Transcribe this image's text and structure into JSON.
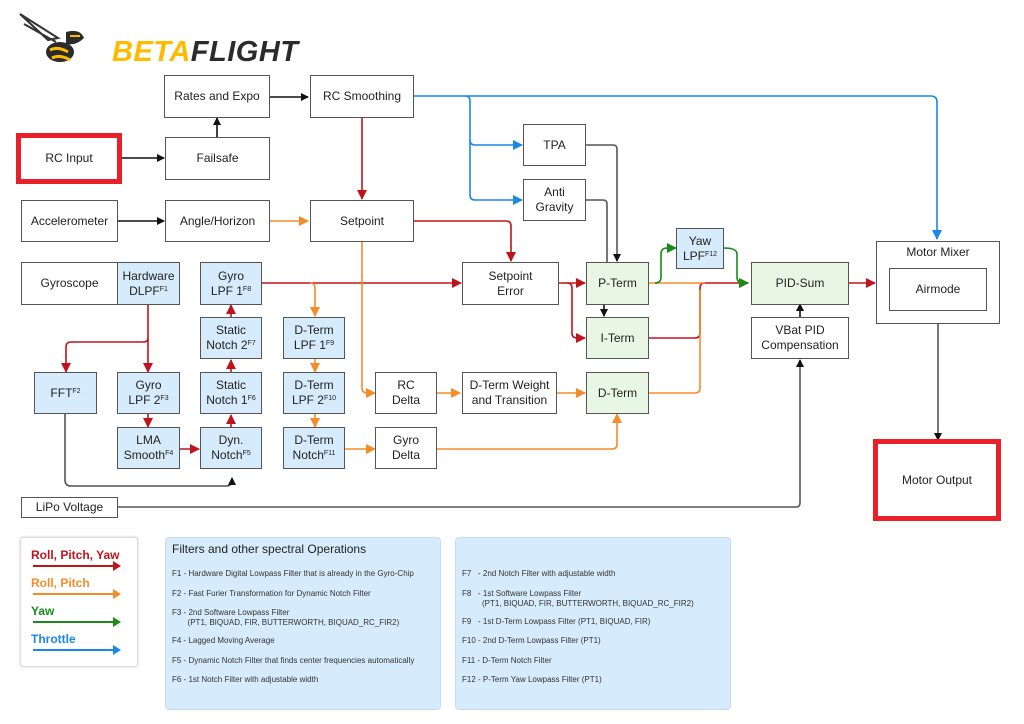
{
  "logo": {
    "beta": "BETA",
    "flight": "FLIGHT",
    "icon": "hornet-icon"
  },
  "colors": {
    "roll_pitch_yaw": "#c0141c",
    "roll_pitch": "#f58c2a",
    "yaw": "#1a8a1a",
    "throttle": "#1a88e8",
    "neutral": "#555555",
    "highlight": "#e8202a",
    "filter_fill": "#d6ebfb",
    "pid_fill": "#e8f7e4"
  },
  "blocks": {
    "rates_expo": "Rates and Expo",
    "rc_smoothing": "RC Smoothing",
    "rc_input": "RC Input",
    "failsafe": "Failsafe",
    "tpa": "TPA",
    "anti_gravity": "Anti Gravity",
    "accelerometer": "Accelerometer",
    "angle_horizon": "Angle/Horizon",
    "setpoint": "Setpoint",
    "gyroscope": "Gyroscope",
    "hardware_dlpf": "Hardware DLPF",
    "hardware_dlpf_sup": "F1",
    "gyro_lpf1": "Gyro LPF 1",
    "gyro_lpf1_sup": "F8",
    "setpoint_error": "Setpoint Error",
    "p_term": "P-Term",
    "i_term": "I-Term",
    "d_term": "D-Term",
    "yaw_lpf": "Yaw LPF",
    "yaw_lpf_sup": "F12",
    "pid_sum": "PID-Sum",
    "motor_mixer": "Motor Mixer",
    "airmode": "Airmode",
    "vbat_pid": "VBat PID Compensation",
    "static_notch2": "Static Notch 2",
    "static_notch2_sup": "F7",
    "dterm_lpf1": "D-Term LPF 1",
    "dterm_lpf1_sup": "F9",
    "fft": "FFT",
    "fft_sup": "F2",
    "gyro_lpf2": "Gyro LPF 2",
    "gyro_lpf2_sup": "F3",
    "static_notch1": "Static Notch 1",
    "static_notch1_sup": "F6",
    "dterm_lpf2": "D-Term LPF 2",
    "dterm_lpf2_sup": "F10",
    "rc_delta": "RC Delta",
    "dterm_weight": "D-Term Weight and Transition",
    "lma_smooth": "LMA Smooth",
    "lma_smooth_sup": "F4",
    "dyn_notch": "Dyn. Notch",
    "dyn_notch_sup": "F5",
    "dterm_notch": "D-Term Notch",
    "dterm_notch_sup": "F11",
    "gyro_delta": "Gyro Delta",
    "lipo_voltage": "LiPo Voltage",
    "motor_output": "Motor Output"
  },
  "legend": [
    {
      "label": "Roll, Pitch, Yaw",
      "color": "#c0141c"
    },
    {
      "label": "Roll, Pitch",
      "color": "#f58c2a"
    },
    {
      "label": "Yaw",
      "color": "#1a8a1a"
    },
    {
      "label": "Throttle",
      "color": "#1a88e8"
    }
  ],
  "notes": {
    "title": "Filters and other spectral Operations",
    "left": [
      "F1 - Hardware Digital Lowpass Filter that is already in the Gyro-Chip",
      "F2 - Fast Furier Transformation for Dynamic Notch Filter",
      "F3 - 2nd Software Lowpass Filter\n       (PT1, BIQUAD, FIR, BUTTERWORTH, BIQUAD_RC_FIR2)",
      "F4 - Lagged Moving Average",
      "F5 - Dynamic Notch Filter that finds center frequencies automatically",
      "F6 - 1st Notch Filter with adjustable width"
    ],
    "right": [
      "F7   - 2nd Notch Filter with adjustable width",
      "F8   - 1st Software Lowpass Filter\n         (PT1, BIQUAD, FIR, BUTTERWORTH, BIQUAD_RC_FIR2)",
      "F9   - 1st D-Term Lowpass Filter (PT1, BIQUAD, FIR)",
      "F10 - 2nd D-Term Lowpass Filter (PT1)",
      "F11 - D-Term Notch Filter",
      "F12 - P-Term Yaw Lowpass Filter (PT1)"
    ]
  }
}
